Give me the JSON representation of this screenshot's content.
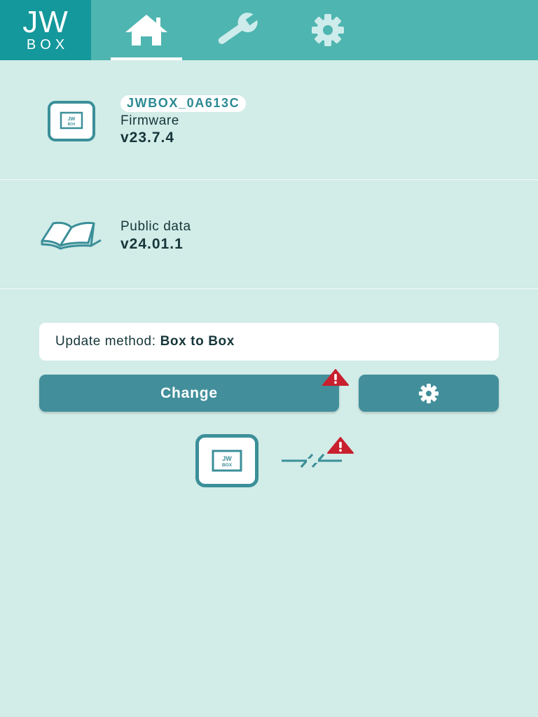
{
  "logo": {
    "line1": "JW",
    "line2": "BOX"
  },
  "nav": {
    "tabs": [
      {
        "name": "home",
        "icon": "home-icon",
        "active": true
      },
      {
        "name": "tools",
        "icon": "wrench-icon",
        "active": false
      },
      {
        "name": "settings",
        "icon": "gear-icon",
        "active": false
      }
    ]
  },
  "device": {
    "name": "JWBOX_0A613C",
    "icon_text_1": "JW",
    "icon_text_2": "BOX",
    "firmware_label": "Firmware",
    "firmware_value": "v23.7.4",
    "icon": "jwbox-device-icon"
  },
  "public_data": {
    "label": "Public data",
    "value": "v24.01.1",
    "icon": "open-book-icon"
  },
  "update": {
    "method_label": "Update method:",
    "method_value": "Box to Box",
    "change_label": "Change",
    "settings_icon": "gear-icon",
    "warning_icon": "warning-triangle-icon",
    "connection_icon": "disconnected-link-icon"
  },
  "colors": {
    "background": "#d2ece8",
    "topbar": "#4fb5b0",
    "logo_bg": "#14989b",
    "button": "#428f9b",
    "warning": "#c8202e",
    "icon_stroke": "#3b8f99"
  }
}
